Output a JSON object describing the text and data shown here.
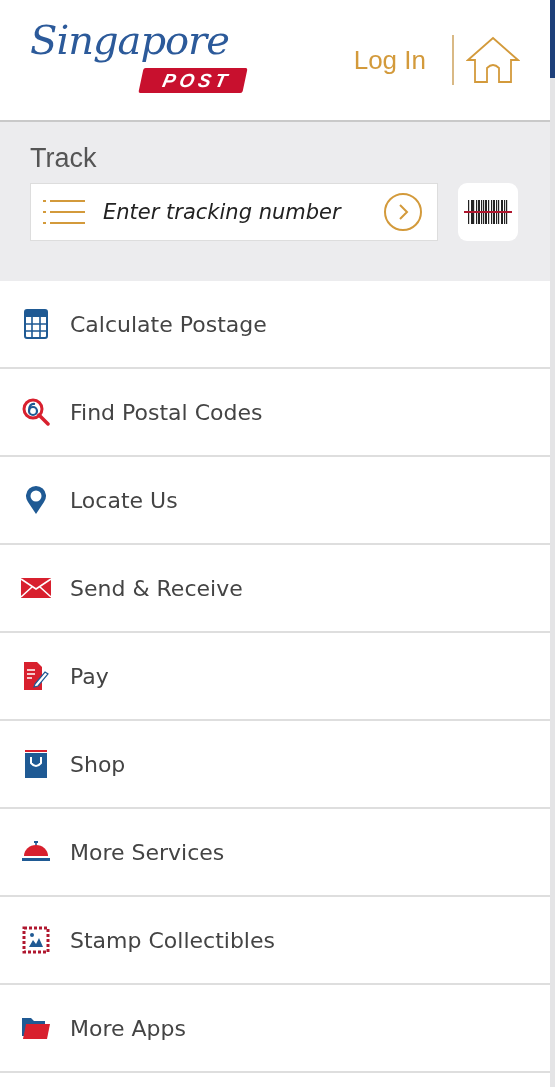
{
  "header": {
    "logo": {
      "script": "Singapore",
      "badge": "POST"
    },
    "login": "Log In"
  },
  "track": {
    "label": "Track",
    "placeholder": "Enter tracking number"
  },
  "menu": [
    {
      "label": "Calculate Postage",
      "kind": "calculator"
    },
    {
      "label": "Find Postal Codes",
      "kind": "postal-search"
    },
    {
      "label": "Locate Us",
      "kind": "pin"
    },
    {
      "label": "Send & Receive",
      "kind": "envelope"
    },
    {
      "label": "Pay",
      "kind": "bill"
    },
    {
      "label": "Shop",
      "kind": "bag"
    },
    {
      "label": "More Services",
      "kind": "bell"
    },
    {
      "label": "Stamp Collectibles",
      "kind": "stamp"
    },
    {
      "label": "More Apps",
      "kind": "folder"
    }
  ]
}
